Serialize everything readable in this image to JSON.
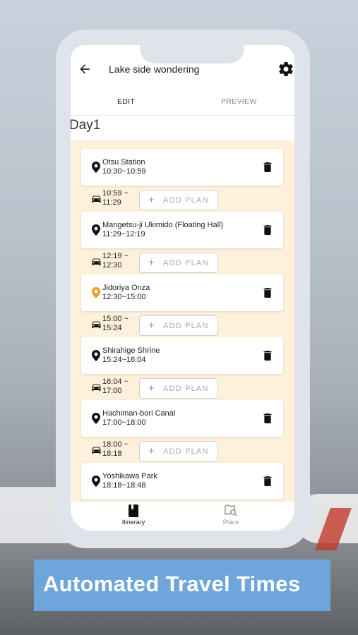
{
  "header": {
    "title": "Lake side wondering"
  },
  "tabs": [
    {
      "label": "EDIT"
    },
    {
      "label": "PREVIEW"
    }
  ],
  "day_label": "Day1",
  "add_plan_label": "ADD PLAN",
  "places": [
    {
      "name": "Otsu Station",
      "time": "10:30~10:59",
      "pin_color": "#111111"
    },
    {
      "name": "Mangetsu-ji Ukimido (Floating Hall)",
      "time": "11:29~12:19",
      "pin_color": "#111111"
    },
    {
      "name": "Jidoriya Onza",
      "time": "12:30~15:00",
      "pin_color": "#f0a020"
    },
    {
      "name": "Shirahige Shrine",
      "time": "15:24~16:04",
      "pin_color": "#111111"
    },
    {
      "name": "Hachiman-bori Canal",
      "time": "17:00~18:00",
      "pin_color": "#111111"
    },
    {
      "name": "Yoshikawa Park",
      "time": "18:18~18:48",
      "pin_color": "#111111"
    }
  ],
  "travels": [
    {
      "start": "10:59 ~",
      "end": "11:29"
    },
    {
      "start": "12:19 ~",
      "end": "12:30"
    },
    {
      "start": "15:00 ~",
      "end": "15:24"
    },
    {
      "start": "16:04 ~",
      "end": "17:00"
    },
    {
      "start": "18:00 ~",
      "end": "18:18"
    }
  ],
  "bottom_nav": [
    {
      "label": "Itinerary"
    },
    {
      "label": "Place"
    }
  ],
  "banner": {
    "text": "Automated Travel Times"
  },
  "colors": {
    "accent_bg": "#fdf1dc",
    "banner": "#6ea6dc",
    "phone_frame": "#dfe3ea"
  }
}
